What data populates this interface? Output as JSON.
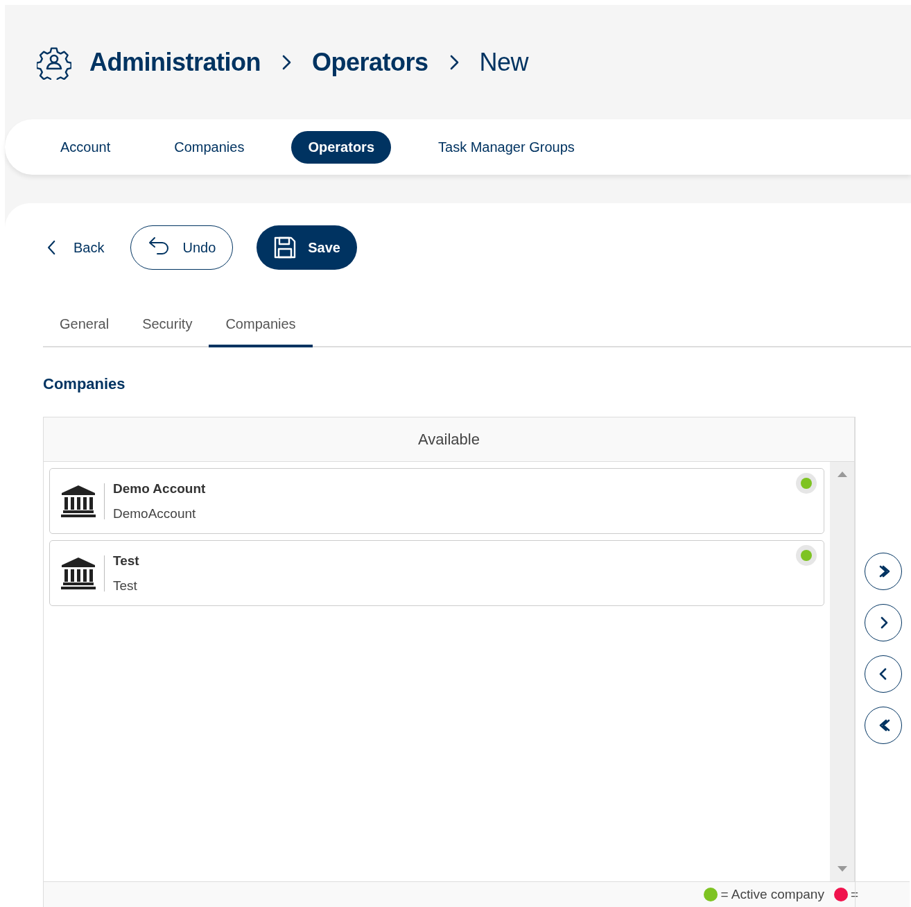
{
  "breadcrumb": [
    {
      "label": "Administration",
      "current": false
    },
    {
      "label": "Operators",
      "current": false
    },
    {
      "label": "New",
      "current": true
    }
  ],
  "tabs": [
    {
      "label": "Account",
      "selected": false
    },
    {
      "label": "Companies",
      "selected": false
    },
    {
      "label": "Operators",
      "selected": true
    },
    {
      "label": "Task Manager Groups",
      "selected": false
    }
  ],
  "toolbar": {
    "back": "Back",
    "undo": "Undo",
    "save": "Save"
  },
  "subtabs": [
    {
      "label": "General",
      "selected": false
    },
    {
      "label": "Security",
      "selected": false
    },
    {
      "label": "Companies",
      "selected": true
    }
  ],
  "section_title": "Companies",
  "available": {
    "title": "Available",
    "items": [
      {
        "name": "Demo Account",
        "code": "DemoAccount",
        "color": "#7ec322"
      },
      {
        "name": "Test",
        "code": "Test",
        "color": "#7ec322"
      }
    ]
  },
  "transfer_buttons": [
    {
      "kind": "all-right"
    },
    {
      "kind": "right"
    },
    {
      "kind": "left"
    },
    {
      "kind": "all-left"
    }
  ],
  "legend": [
    {
      "color": "#7ec322",
      "text": "= Active company"
    },
    {
      "color": "#f0134d",
      "text": "="
    }
  ]
}
